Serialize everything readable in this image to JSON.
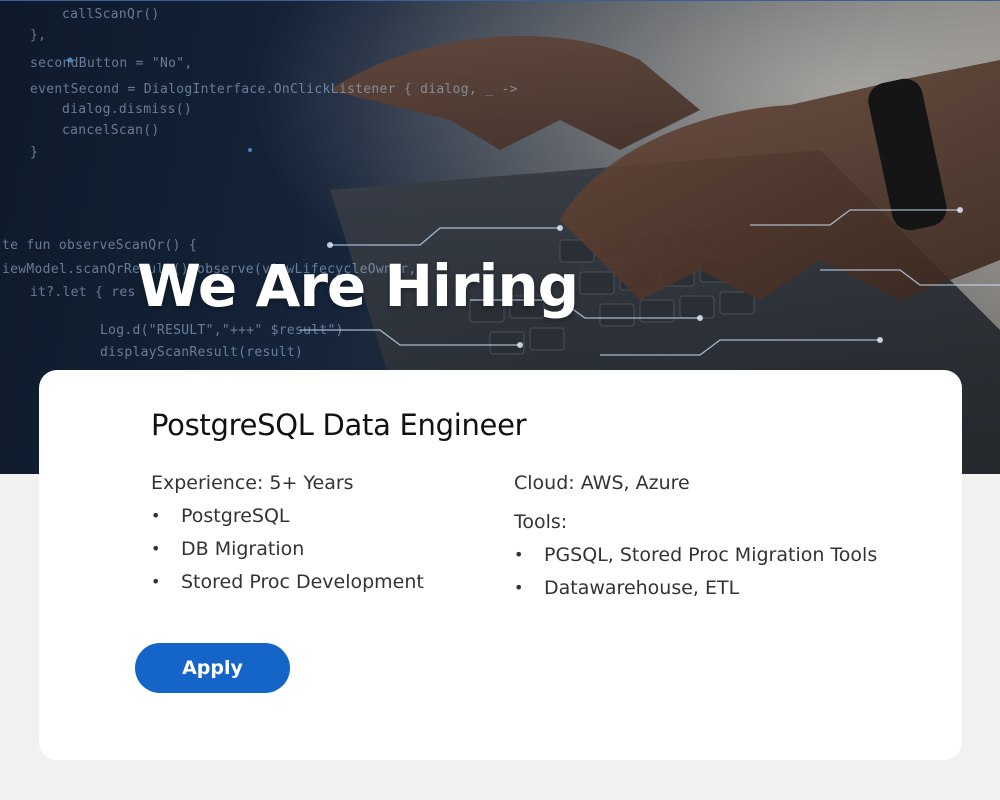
{
  "hero": {
    "headline": "We Are Hiring",
    "code_lines": [
      "callScanQr()",
      "},",
      "secondButton = \"No\",",
      "eventSecond = DialogInterface.OnClickListener { dialog, _ ->",
      "dialog.dismiss()",
      "cancelScan()",
      "}",
      "te fun observeScanQr() {",
      "iewModel.scanQrResult().observe(viewLifecycleOwner,",
      "it?.let { res",
      "Log.d(\"RESULT\",\"+++\" $result\")",
      "displayScanResult(result)"
    ]
  },
  "job": {
    "title": "PostgreSQL Data Engineer",
    "experience": "Experience: 5+ Years",
    "skills": [
      "PostgreSQL",
      "DB Migration",
      "Stored Proc Development"
    ],
    "cloud": "Cloud: AWS, Azure",
    "tools_label": "Tools:",
    "tools": [
      "PGSQL, Stored Proc Migration Tools",
      "Datawarehouse, ETL"
    ],
    "bullet": "•"
  },
  "apply_label": "Apply",
  "colors": {
    "button": "#1565c8",
    "card": "#ffffff",
    "page": "#f1f1f1"
  }
}
